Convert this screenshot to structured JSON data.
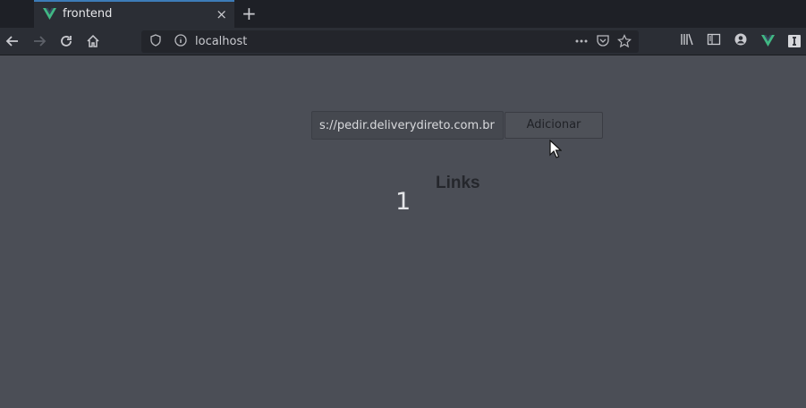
{
  "browser": {
    "tab": {
      "title": "frontend",
      "close_glyph": "×",
      "favicon": "vue-icon"
    },
    "new_tab_glyph": "+",
    "url": "localhost"
  },
  "page": {
    "input_value": "s://pedir.deliverydireto.com.br",
    "add_button_label": "Adicionar",
    "heading": "Links",
    "count": "1"
  },
  "colors": {
    "page_background": "#4b4e56",
    "browser_chrome": "#2b2e35",
    "tab_accent": "#3d7cb8",
    "vue_green": "#41b883"
  }
}
